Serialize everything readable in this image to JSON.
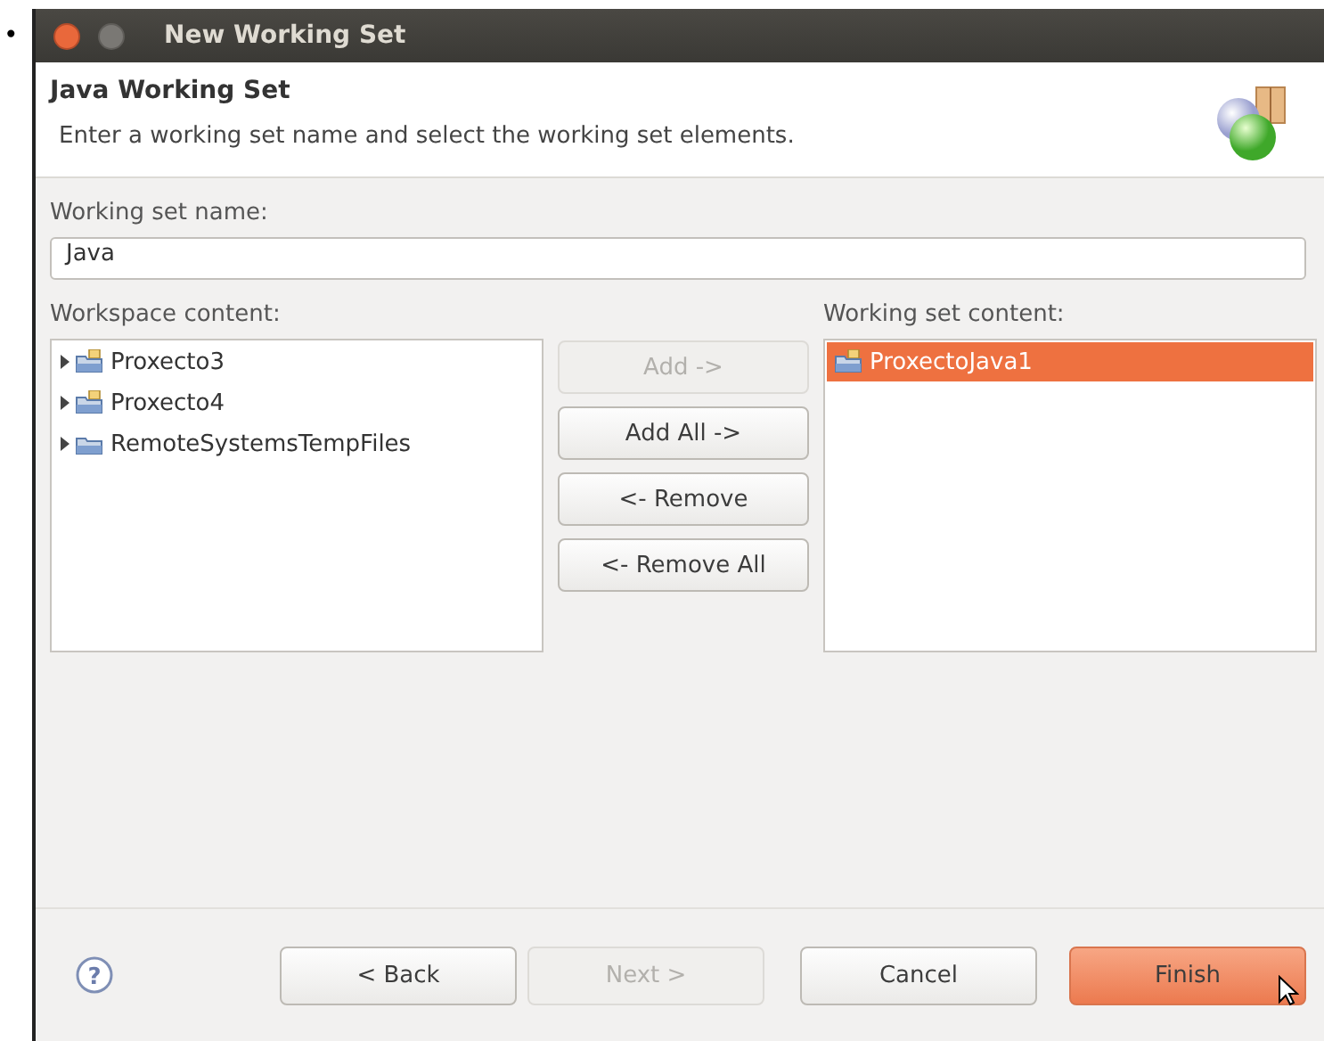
{
  "bullet": "•",
  "help_icon": "?",
  "window": {
    "title": "New Working Set"
  },
  "header": {
    "title": "Java Working Set",
    "description": "Enter a working set name and select the working set elements."
  },
  "name_field": {
    "label": "Working set name:",
    "value": "Java"
  },
  "workspace": {
    "label": "Workspace content:",
    "items": [
      {
        "label": "Proxecto3",
        "kind": "project",
        "expanded": false
      },
      {
        "label": "Proxecto4",
        "kind": "project",
        "expanded": false
      },
      {
        "label": "RemoteSystemsTempFiles",
        "kind": "folder",
        "expanded": false
      }
    ]
  },
  "move_buttons": [
    {
      "label": "Add ->",
      "disabled": true
    },
    {
      "label": "Add All ->",
      "disabled": false
    },
    {
      "label": "<- Remove",
      "disabled": false
    },
    {
      "label": "<- Remove All",
      "disabled": false
    }
  ],
  "working_set": {
    "label": "Working set content:",
    "items": [
      {
        "label": "ProxectoJava1",
        "kind": "project",
        "selected": true
      }
    ]
  },
  "footer_buttons": [
    {
      "label": "< Back",
      "disabled": false,
      "default": false
    },
    {
      "label": "Next >",
      "disabled": true,
      "default": false
    },
    {
      "label": "Cancel",
      "disabled": false,
      "default": false
    },
    {
      "label": "Finish",
      "disabled": false,
      "default": true
    }
  ]
}
